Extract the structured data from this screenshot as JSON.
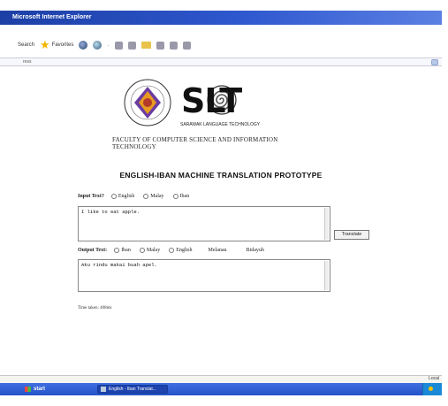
{
  "window": {
    "title": "Microsoft Internet Explorer"
  },
  "toolbar": {
    "search_label": "Search",
    "favorites_label": "Favorites"
  },
  "address": {
    "label": "ress"
  },
  "logo": {
    "wordmark": "SLT",
    "subtitle": "SARAWAK LANGUAGE TECHNOLOGY",
    "faculty": "FACULTY OF COMPUTER SCIENCE AND INFORMATION TECHNOLOGY"
  },
  "page": {
    "heading": "ENGLISH-IBAN MACHINE TRANSLATION PROTOTYPE"
  },
  "input": {
    "label": "Input Text?",
    "options": [
      "English",
      "Malay",
      "Iban"
    ],
    "value": "I like to eat apple."
  },
  "output": {
    "label": "Output Text:",
    "options": [
      "Iban",
      "Malay",
      "English"
    ],
    "extra_labels": [
      "Melanau",
      "Bidayuh"
    ],
    "value": "Aku rindu makai buah apel."
  },
  "translate_button": "Translate",
  "time_taken": "Time taken: 408ms",
  "statusbar": {
    "zone": "Local"
  },
  "taskbar": {
    "start_label": "start",
    "task_label": "English - Iban Translat..."
  }
}
